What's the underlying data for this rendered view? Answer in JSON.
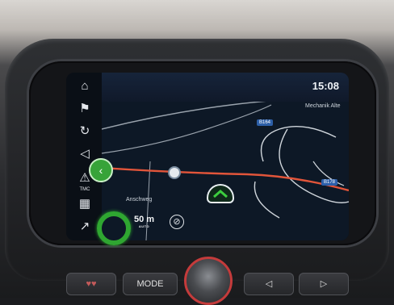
{
  "status": {
    "clock": "15:08"
  },
  "sidebar": {
    "items": [
      {
        "icon": "home-icon",
        "glyph": "⌂",
        "extra": ""
      },
      {
        "icon": "destination-flag-icon",
        "glyph": "⚑",
        "extra": ""
      },
      {
        "icon": "route-options-icon",
        "glyph": "↻",
        "extra": ""
      },
      {
        "icon": "voice-guidance-icon",
        "glyph": "◁",
        "extra": ""
      },
      {
        "icon": "traffic-tmc-icon",
        "glyph": "⚠",
        "extra": "TMC"
      },
      {
        "icon": "map-view-icon",
        "glyph": "▦",
        "extra": ""
      },
      {
        "icon": "route-arrow-icon",
        "glyph": "↗",
        "extra": ""
      }
    ]
  },
  "map": {
    "roads": [
      {
        "label": "B164"
      },
      {
        "label": "B178"
      }
    ],
    "places": [
      {
        "label": "Anschweg"
      },
      {
        "label": "Mechanik Alte"
      }
    ],
    "scale": {
      "value": "50 m",
      "mode": "AUTO"
    },
    "compass_glyph": "⊘",
    "route_color": "#e2553a"
  },
  "controls": {
    "mode_label": "MODE",
    "left_label": "◁",
    "right_label": "▷",
    "fav_label": "♥♥"
  }
}
